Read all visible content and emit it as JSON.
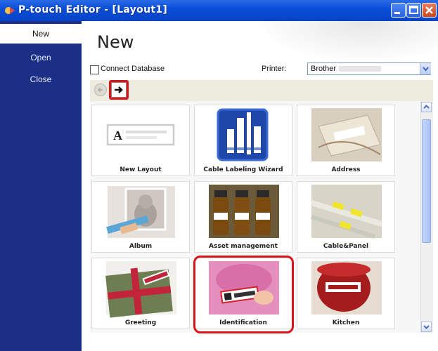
{
  "window": {
    "title": "P-touch Editor - [Layout1]"
  },
  "sidebar": {
    "items": [
      {
        "label": "New",
        "active": true
      },
      {
        "label": "Open",
        "active": false
      },
      {
        "label": "Close",
        "active": false
      }
    ]
  },
  "main": {
    "title": "New",
    "connect_database": {
      "label": "Connect Database",
      "checked": false
    },
    "printer": {
      "label": "Printer:",
      "value": "Brother"
    }
  },
  "templates": [
    {
      "label": "New Layout",
      "icon": "new-layout-icon"
    },
    {
      "label": "Cable Labeling Wizard",
      "icon": "cable-wizard-icon"
    },
    {
      "label": "Address",
      "icon": "address-photo"
    },
    {
      "label": "Album",
      "icon": "album-photo"
    },
    {
      "label": "Asset management",
      "icon": "asset-photo"
    },
    {
      "label": "Cable&Panel",
      "icon": "cable-panel-photo"
    },
    {
      "label": "Greeting",
      "icon": "greeting-photo"
    },
    {
      "label": "Identification",
      "icon": "identification-photo",
      "highlighted": true
    },
    {
      "label": "Kitchen",
      "icon": "kitchen-photo"
    }
  ],
  "colors": {
    "sidebar": "#1c2f86",
    "titlebar": "#0a4fd8",
    "highlight": "#d9141a"
  }
}
